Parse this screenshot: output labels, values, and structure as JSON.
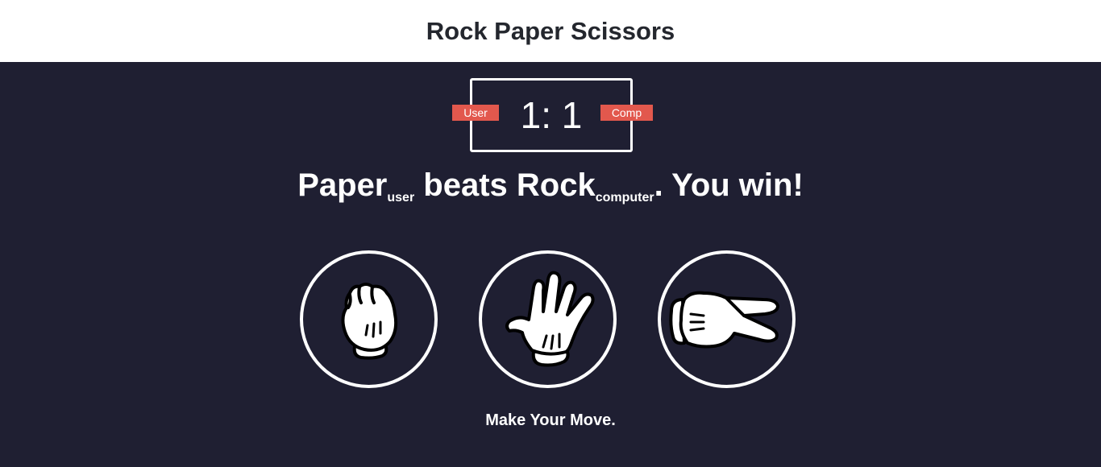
{
  "header": {
    "title": "Rock Paper Scissors"
  },
  "scoreboard": {
    "user_label": "User",
    "comp_label": "Comp",
    "score_text": "1: 1",
    "user_score": 1,
    "comp_score": 1
  },
  "result": {
    "user_choice": "Paper",
    "user_tag": "user",
    "middle_text": " beats ",
    "comp_choice": "Rock",
    "comp_tag": "computer",
    "outcome": ". You win!"
  },
  "choices": [
    {
      "id": "rock",
      "icon": "rock-hand-icon"
    },
    {
      "id": "paper",
      "icon": "paper-hand-icon"
    },
    {
      "id": "scissors",
      "icon": "scissors-hand-icon"
    }
  ],
  "prompt": "Make Your Move.",
  "colors": {
    "background": "#1f1f32",
    "header_bg": "#ffffff",
    "accent": "#e2584d",
    "text": "#ffffff"
  }
}
